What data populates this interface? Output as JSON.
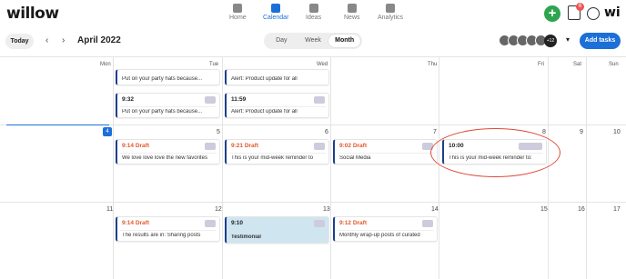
{
  "logo": "willow",
  "nav": [
    {
      "label": "Home"
    },
    {
      "label": "Calendar"
    },
    {
      "label": "Ideas"
    },
    {
      "label": "News"
    },
    {
      "label": "Analytics"
    }
  ],
  "notifications": "6",
  "brand_short": "wi",
  "toolbar": {
    "today": "Today",
    "title": "April 2022",
    "views": [
      "Day",
      "Week",
      "Month"
    ],
    "more_avatars": "+12",
    "add_tasks": "Add tasks"
  },
  "days": [
    "Mon",
    "Tue",
    "Wed",
    "Thu",
    "Fri",
    "Sat",
    "Sun"
  ],
  "week1": {
    "cards": [
      {
        "title": "9:32",
        "text": "Put on your party hats because..."
      },
      {
        "title": "11:59",
        "text": "Alert: Product update for all"
      },
      {
        "title": "",
        "text": "Put on your party hats because..."
      },
      {
        "title": "",
        "text": "Alert: Product update for all"
      }
    ]
  },
  "week2": {
    "nums": [
      "4",
      "5",
      "6",
      "7",
      "8",
      "9",
      "10"
    ],
    "cards": [
      {
        "title": "9:14 Draft",
        "text": "We love love love the new favorites"
      },
      {
        "title": "9:21 Draft",
        "text": "This is your mid-week reminder to"
      },
      {
        "title": "9:02 Draft",
        "text": "Social Media"
      },
      {
        "title": "10:00",
        "text": "This is your mid-week reminder to:"
      }
    ]
  },
  "week3": {
    "nums": [
      "11",
      "12",
      "13",
      "14",
      "15",
      "16",
      "17"
    ],
    "cards": [
      {
        "title": "9:14 Draft",
        "text": "The results are in: Sharing posts"
      },
      {
        "title": "9:10",
        "text": "Testimonial"
      },
      {
        "title": "9:12 Draft",
        "text": "Monthly wrap-up posts of curated"
      }
    ]
  }
}
